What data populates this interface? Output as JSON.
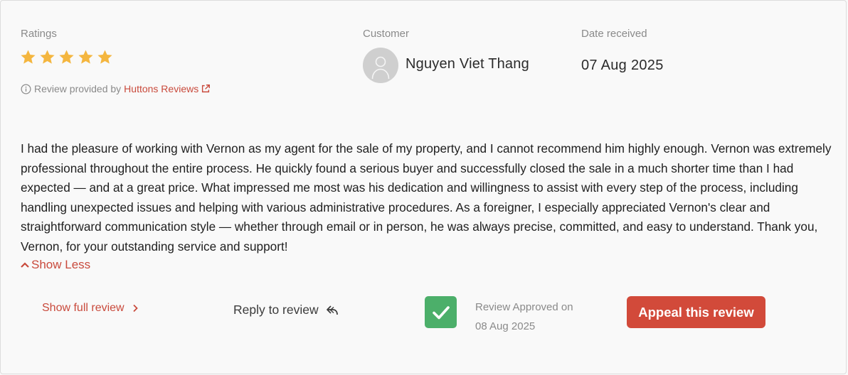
{
  "ratings": {
    "label": "Ratings",
    "stars": 5,
    "max_stars": 5,
    "star_color": "#f4b63f",
    "provided_prefix": "Review provided by",
    "provider_link": "Huttons Reviews",
    "link_color": "#c94a3c",
    "info_icon": "info-icon",
    "external_icon": "external-link-icon"
  },
  "customer": {
    "label": "Customer",
    "name": "Nguyen Viet Thang",
    "avatar_icon": "user-avatar-icon"
  },
  "date": {
    "label": "Date received",
    "value": "07 Aug 2025"
  },
  "review": {
    "text": "I had the pleasure of working with Vernon as my agent for the sale of my property, and I cannot recommend him highly enough. Vernon was extremely professional throughout the entire process. He quickly found a serious buyer and successfully closed the sale in a much shorter time than I had expected — and at a great price. What impressed me most was his dedication and willingness to assist with every step of the process, including handling unexpected issues and helping with various administrative procedures. As a foreigner, I especially appreciated Vernon's clear and straightforward communication style — whether through email or in person, he was always precise, committed, and easy to understand. Thank you, Vernon, for your outstanding service and support!",
    "show_less_label": "Show Less"
  },
  "actions": {
    "show_full_label": "Show full review",
    "reply_label": "Reply to review",
    "approved_label": "Review Approved on",
    "approved_date": "08 Aug 2025",
    "approved_color": "#4caf6a",
    "appeal_label": "Appeal this review",
    "appeal_color": "#d24a3a"
  }
}
